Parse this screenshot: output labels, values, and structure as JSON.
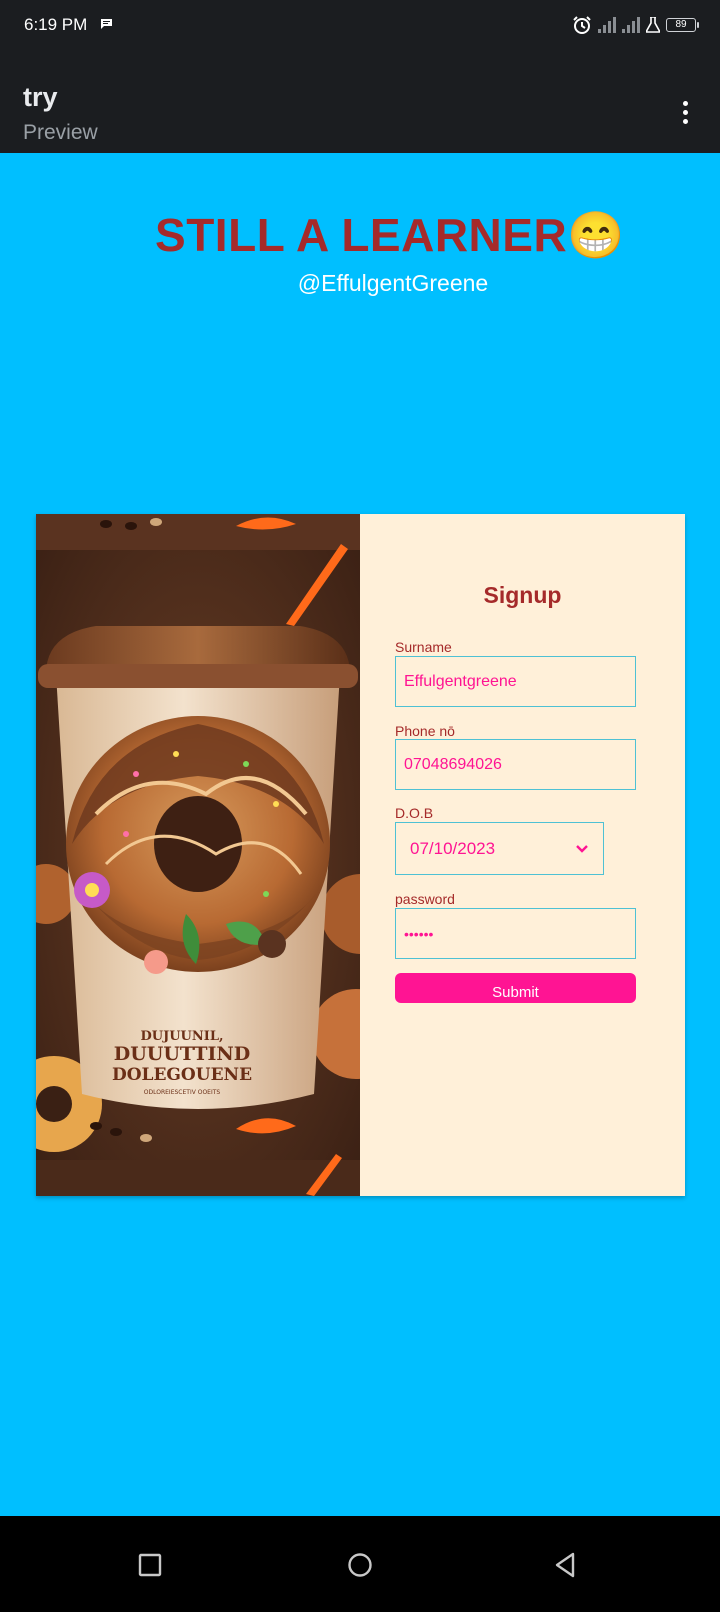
{
  "status_bar": {
    "time": "6:19 PM",
    "battery": "89",
    "icons": [
      "message-icon",
      "alarm-icon",
      "signal-icon",
      "signal-icon",
      "flask-icon",
      "battery-icon"
    ]
  },
  "app_bar": {
    "title": "try",
    "subtitle": "Preview",
    "menu_icon": "more-vert-icon"
  },
  "header": {
    "headline": "STILL A LEARNER😁",
    "handle": "@EffulgentGreene"
  },
  "signup_form": {
    "title": "Signup",
    "fields": {
      "surname": {
        "label": "Surname",
        "value": "Effulgentgreene"
      },
      "phone": {
        "label": "Phone nō",
        "value": "07048694026"
      },
      "dob": {
        "label": "D.O.B",
        "value": "07/10/2023"
      },
      "password": {
        "label": "password",
        "value": "••••••"
      }
    },
    "submit_label": "Submit"
  },
  "hero_image": {
    "cup_text_line1": "DUJUUNIL,",
    "cup_text_line2": "DUUUTTIND",
    "cup_text_line3": "DOLEGOUENE",
    "cup_text_small": "ODLOREIESCETIV OOEITS"
  },
  "colors": {
    "page_background": "#00bfff",
    "headline": "#a52a2a",
    "form_background": "#fff0d9",
    "accent": "#ff1493",
    "input_border": "#4ec1d4",
    "system_bar": "#1b1d20"
  },
  "nav_bar": {
    "icons": [
      "recent-apps-icon",
      "home-icon",
      "back-icon"
    ]
  }
}
